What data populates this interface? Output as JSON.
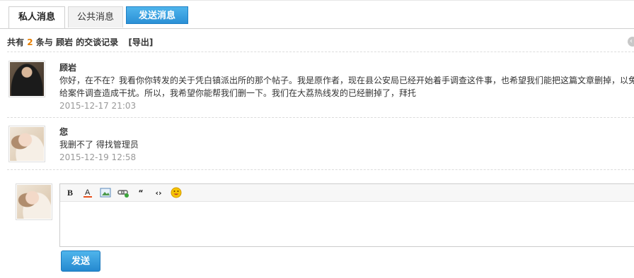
{
  "tabs": {
    "private_label": "私人消息",
    "public_label": "公共消息",
    "send_label": "发送消息"
  },
  "summary": {
    "prefix": "共有",
    "count": "2",
    "middle": "条与",
    "contact": "顾岩",
    "suffix": "的交谈记录",
    "export_label": "[导出]"
  },
  "messages": [
    {
      "author": "顾岩",
      "line1": "你好，在不在？我看你你转发的关于凭白镇派出所的那个帖子。我是原作者，现在县公安局已经开始着手调查这件事，也希望我们能把这篇文章删掉，以免",
      "line2": "给案件调查造成干扰。所以，我希望你能帮我们删一下。我们在大荔热线发的已经删掉了，拜托",
      "time": "2015-12-17 21:03"
    },
    {
      "author": "您",
      "line1": "我删不了 得找管理员",
      "time": "2015-12-19 12:58"
    }
  ],
  "editor": {
    "tools": [
      "bold-icon",
      "font-color-icon",
      "image-icon",
      "link-icon",
      "quote-icon",
      "code-icon",
      "smiley-icon"
    ]
  },
  "send_button_label": "发送",
  "colors": {
    "accent": "#2b90d6",
    "count": "#e67e00",
    "time": "#999999"
  }
}
